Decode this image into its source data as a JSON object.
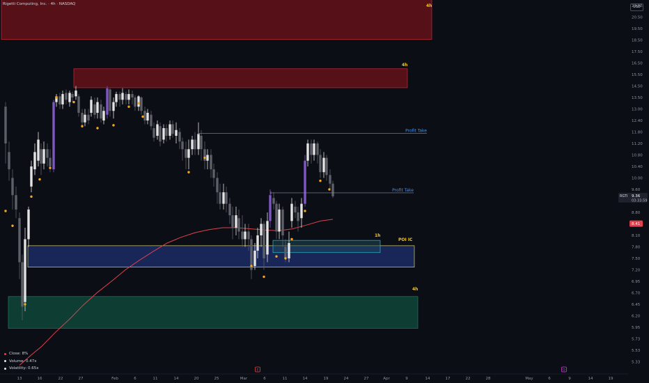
{
  "header": {
    "title": "Rigetti Computing, Inc. · 4h · NASDAQ",
    "currency": "USD"
  },
  "legend": [
    {
      "label": "Close: 8%",
      "color": "#e8e8e8"
    },
    {
      "label": "Volume: 0.47x",
      "color": "#e8e8e8"
    },
    {
      "label": "Volatility: 0.65x",
      "color": "#e8e8e8"
    }
  ],
  "colors": {
    "bull": "#e3e3e3",
    "bear": "#5d6068",
    "impulse": "#7e57c2",
    "dot": "#f5a623",
    "ma": "#e0414c",
    "supply": "#6b1219",
    "poi": "#1c2d6b",
    "demand": "#0f4a3c",
    "accent": "#f5c518"
  },
  "chart_data": {
    "type": "candlestick",
    "symbol": "RGTI",
    "timeframe": "4h",
    "y_ticks": [
      "20.95",
      "20.50",
      "19.50",
      "18.50",
      "17.50",
      "16.50",
      "15.50",
      "14.50",
      "13.50",
      "13.00",
      "12.40",
      "11.80",
      "11.20",
      "10.80",
      "10.40",
      "10.00",
      "9.60",
      "9.20",
      "8.80",
      "8.40",
      "8.10",
      "7.80",
      "7.50",
      "7.20",
      "6.95",
      "6.70",
      "6.45",
      "6.20",
      "5.95",
      "5.73",
      "5.53",
      "5.33"
    ],
    "x_ticks": [
      "13",
      "16",
      "22",
      "27",
      "Feb",
      "6",
      "11",
      "14",
      "20",
      "25",
      "Mar",
      "6",
      "11",
      "14",
      "19",
      "24",
      "27",
      "Apr",
      "9",
      "14",
      "17",
      "22",
      "28",
      "May",
      "6",
      "9",
      "14",
      "19"
    ],
    "price_label": {
      "symbol": "RGTI",
      "price": "9.36",
      "countdown": "03:33:59",
      "color": "#1e222d"
    },
    "ma_label": {
      "value": "8.41",
      "color": "#e0414c"
    },
    "candles": [
      {
        "x": 8,
        "o": 13.1,
        "c": 11.2,
        "h": 13.3,
        "l": 10.5
      },
      {
        "x": 13,
        "o": 10.9,
        "c": 10.3,
        "h": 11.3,
        "l": 9.9
      },
      {
        "x": 18,
        "o": 10.0,
        "c": 9.4,
        "h": 10.3,
        "l": 8.9
      },
      {
        "x": 23,
        "o": 9.4,
        "c": 8.9,
        "h": 9.7,
        "l": 8.6
      },
      {
        "x": 28,
        "o": 8.6,
        "c": 7.4,
        "h": 8.8,
        "l": 7.0
      },
      {
        "x": 32,
        "o": 7.4,
        "c": 6.4,
        "h": 7.6,
        "l": 6.1
      },
      {
        "x": 36,
        "o": 6.5,
        "c": 8.0,
        "h": 8.3,
        "l": 6.3
      },
      {
        "x": 41,
        "o": 8.0,
        "c": 8.9,
        "h": 9.0,
        "l": 7.8
      },
      {
        "x": 45,
        "o": 9.7,
        "c": 10.4,
        "h": 10.6,
        "l": 9.5
      },
      {
        "x": 50,
        "o": 10.3,
        "c": 10.9,
        "h": 11.2,
        "l": 10.1
      },
      {
        "x": 55,
        "o": 10.6,
        "c": 11.4,
        "h": 11.8,
        "l": 10.4
      },
      {
        "x": 59,
        "o": 11.0,
        "c": 10.5,
        "h": 11.2,
        "l": 10.1
      },
      {
        "x": 63,
        "o": 10.5,
        "c": 11.0,
        "h": 11.3,
        "l": 10.3
      },
      {
        "x": 68,
        "o": 11.0,
        "c": 10.7,
        "h": 11.2,
        "l": 10.4
      },
      {
        "x": 72,
        "o": 10.7,
        "c": 10.4,
        "h": 11.0,
        "l": 10.2
      },
      {
        "x": 77,
        "o": 10.3,
        "c": 13.3,
        "h": 13.4,
        "l": 10.2
      },
      {
        "x": 81,
        "o": 13.3,
        "c": 13.6,
        "h": 13.8,
        "l": 13.1
      },
      {
        "x": 86,
        "o": 13.6,
        "c": 13.2,
        "h": 13.9,
        "l": 13.0
      },
      {
        "x": 90,
        "o": 13.2,
        "c": 13.8,
        "h": 14.1,
        "l": 13.0
      },
      {
        "x": 95,
        "o": 13.9,
        "c": 13.4,
        "h": 14.2,
        "l": 13.2
      },
      {
        "x": 100,
        "o": 13.3,
        "c": 13.9,
        "h": 14.1,
        "l": 13.1
      },
      {
        "x": 104,
        "o": 13.8,
        "c": 13.5,
        "h": 14.0,
        "l": 13.3
      },
      {
        "x": 109,
        "o": 13.6,
        "c": 14.1,
        "h": 14.5,
        "l": 13.4
      },
      {
        "x": 113,
        "o": 13.6,
        "c": 12.8,
        "h": 13.8,
        "l": 12.6
      },
      {
        "x": 118,
        "o": 12.8,
        "c": 12.3,
        "h": 13.0,
        "l": 12.1
      },
      {
        "x": 122,
        "o": 12.3,
        "c": 12.7,
        "h": 13.0,
        "l": 12.1
      },
      {
        "x": 127,
        "o": 12.7,
        "c": 12.4,
        "h": 13.0,
        "l": 12.2
      },
      {
        "x": 131,
        "o": 12.8,
        "c": 13.4,
        "h": 13.6,
        "l": 12.6
      },
      {
        "x": 136,
        "o": 13.2,
        "c": 12.7,
        "h": 13.5,
        "l": 12.5
      },
      {
        "x": 140,
        "o": 12.8,
        "c": 13.3,
        "h": 13.5,
        "l": 12.5
      },
      {
        "x": 145,
        "o": 13.2,
        "c": 12.5,
        "h": 13.4,
        "l": 12.3
      },
      {
        "x": 149,
        "o": 12.4,
        "c": 12.9,
        "h": 13.1,
        "l": 12.2
      },
      {
        "x": 154,
        "o": 12.7,
        "c": 14.3,
        "h": 14.5,
        "l": 12.5
      },
      {
        "x": 158,
        "o": 14.2,
        "c": 12.9,
        "h": 14.3,
        "l": 12.6
      },
      {
        "x": 163,
        "o": 12.9,
        "c": 13.3,
        "h": 13.5,
        "l": 12.5
      },
      {
        "x": 167,
        "o": 13.3,
        "c": 13.8,
        "h": 14.0,
        "l": 13.1
      },
      {
        "x": 172,
        "o": 13.8,
        "c": 13.4,
        "h": 14.0,
        "l": 13.1
      },
      {
        "x": 176,
        "o": 13.4,
        "c": 13.9,
        "h": 14.3,
        "l": 13.2
      },
      {
        "x": 181,
        "o": 13.8,
        "c": 13.4,
        "h": 14.0,
        "l": 13.2
      },
      {
        "x": 185,
        "o": 13.4,
        "c": 13.8,
        "h": 14.2,
        "l": 13.2
      },
      {
        "x": 190,
        "o": 13.8,
        "c": 13.5,
        "h": 14.1,
        "l": 13.2
      },
      {
        "x": 194,
        "o": 13.5,
        "c": 13.1,
        "h": 13.7,
        "l": 12.9
      },
      {
        "x": 199,
        "o": 13.1,
        "c": 13.6,
        "h": 13.7,
        "l": 12.9
      },
      {
        "x": 203,
        "o": 13.5,
        "c": 12.9,
        "h": 13.6,
        "l": 12.7
      },
      {
        "x": 208,
        "o": 12.9,
        "c": 12.4,
        "h": 13.1,
        "l": 12.2
      },
      {
        "x": 212,
        "o": 12.4,
        "c": 12.8,
        "h": 13.0,
        "l": 12.2
      },
      {
        "x": 217,
        "o": 12.7,
        "c": 12.1,
        "h": 12.9,
        "l": 11.9
      },
      {
        "x": 221,
        "o": 12.0,
        "c": 11.5,
        "h": 12.3,
        "l": 11.3
      },
      {
        "x": 226,
        "o": 11.6,
        "c": 12.2,
        "h": 12.4,
        "l": 11.4
      },
      {
        "x": 230,
        "o": 12.1,
        "c": 11.3,
        "h": 12.3,
        "l": 11.1
      },
      {
        "x": 235,
        "o": 11.4,
        "c": 12.0,
        "h": 12.2,
        "l": 11.2
      },
      {
        "x": 239,
        "o": 12.0,
        "c": 11.6,
        "h": 12.2,
        "l": 11.3
      },
      {
        "x": 244,
        "o": 11.6,
        "c": 12.2,
        "h": 12.4,
        "l": 11.4
      },
      {
        "x": 248,
        "o": 12.2,
        "c": 11.7,
        "h": 12.4,
        "l": 11.5
      },
      {
        "x": 253,
        "o": 11.6,
        "c": 11.9,
        "h": 12.3,
        "l": 11.2
      },
      {
        "x": 258,
        "o": 11.8,
        "c": 11.3,
        "h": 12.0,
        "l": 11.0
      },
      {
        "x": 262,
        "o": 11.3,
        "c": 11.0,
        "h": 11.5,
        "l": 10.6
      },
      {
        "x": 267,
        "o": 11.0,
        "c": 10.7,
        "h": 11.3,
        "l": 10.3
      },
      {
        "x": 271,
        "o": 10.7,
        "c": 11.0,
        "h": 11.4,
        "l": 10.3
      },
      {
        "x": 276,
        "o": 11.0,
        "c": 11.4,
        "h": 11.6,
        "l": 10.8
      },
      {
        "x": 280,
        "o": 11.4,
        "c": 11.0,
        "h": 11.8,
        "l": 10.8
      },
      {
        "x": 285,
        "o": 11.0,
        "c": 11.7,
        "h": 12.3,
        "l": 10.8
      },
      {
        "x": 289,
        "o": 11.6,
        "c": 11.0,
        "h": 11.9,
        "l": 10.6
      },
      {
        "x": 294,
        "o": 11.0,
        "c": 10.6,
        "h": 11.3,
        "l": 10.3
      },
      {
        "x": 298,
        "o": 10.6,
        "c": 10.8,
        "h": 11.0,
        "l": 10.3
      },
      {
        "x": 303,
        "o": 10.8,
        "c": 10.3,
        "h": 11.0,
        "l": 10.0
      },
      {
        "x": 307,
        "o": 10.3,
        "c": 10.0,
        "h": 10.5,
        "l": 9.7
      },
      {
        "x": 312,
        "o": 10.0,
        "c": 9.5,
        "h": 10.2,
        "l": 9.1
      },
      {
        "x": 316,
        "o": 9.5,
        "c": 9.1,
        "h": 9.8,
        "l": 8.9
      },
      {
        "x": 321,
        "o": 9.1,
        "c": 9.5,
        "h": 9.8,
        "l": 8.9
      },
      {
        "x": 325,
        "o": 9.5,
        "c": 9.1,
        "h": 9.7,
        "l": 8.8
      },
      {
        "x": 330,
        "o": 9.1,
        "c": 8.7,
        "h": 9.3,
        "l": 8.4
      },
      {
        "x": 334,
        "o": 8.7,
        "c": 8.3,
        "h": 9.0,
        "l": 8.0
      },
      {
        "x": 339,
        "o": 8.3,
        "c": 8.7,
        "h": 9.0,
        "l": 8.1
      },
      {
        "x": 343,
        "o": 8.6,
        "c": 8.2,
        "h": 8.9,
        "l": 8.0
      },
      {
        "x": 348,
        "o": 8.2,
        "c": 8.0,
        "h": 8.7,
        "l": 7.8
      },
      {
        "x": 352,
        "o": 8.0,
        "c": 8.2,
        "h": 8.4,
        "l": 7.8
      },
      {
        "x": 357,
        "o": 8.2,
        "c": 8.0,
        "h": 8.4,
        "l": 7.7
      },
      {
        "x": 361,
        "o": 8.0,
        "c": 7.2,
        "h": 8.1,
        "l": 7.0
      },
      {
        "x": 366,
        "o": 7.3,
        "c": 7.7,
        "h": 7.9,
        "l": 7.2
      },
      {
        "x": 370,
        "o": 7.7,
        "c": 8.1,
        "h": 8.3,
        "l": 7.5
      },
      {
        "x": 375,
        "o": 8.1,
        "c": 8.4,
        "h": 8.6,
        "l": 7.8
      },
      {
        "x": 379,
        "o": 8.4,
        "c": 7.5,
        "h": 8.5,
        "l": 7.2
      },
      {
        "x": 384,
        "o": 7.6,
        "c": 8.5,
        "h": 8.8,
        "l": 7.4
      },
      {
        "x": 388,
        "o": 8.5,
        "c": 9.4,
        "h": 9.6,
        "l": 8.3
      },
      {
        "x": 393,
        "o": 9.3,
        "c": 9.1,
        "h": 9.5,
        "l": 8.9
      },
      {
        "x": 397,
        "o": 9.1,
        "c": 8.2,
        "h": 9.2,
        "l": 8.0
      },
      {
        "x": 401,
        "o": 8.2,
        "c": 8.9,
        "h": 9.1,
        "l": 8.0
      },
      {
        "x": 406,
        "o": 8.9,
        "c": 8.1,
        "h": 9.0,
        "l": 7.8
      },
      {
        "x": 410,
        "o": 7.8,
        "c": 7.5,
        "h": 8.0,
        "l": 7.4
      },
      {
        "x": 415,
        "o": 7.5,
        "c": 7.9,
        "h": 8.2,
        "l": 7.4
      },
      {
        "x": 419,
        "o": 8.5,
        "c": 9.1,
        "h": 9.3,
        "l": 8.3
      },
      {
        "x": 424,
        "o": 9.0,
        "c": 8.8,
        "h": 9.2,
        "l": 8.6
      },
      {
        "x": 428,
        "o": 8.8,
        "c": 8.5,
        "h": 9.0,
        "l": 8.2
      },
      {
        "x": 433,
        "o": 8.6,
        "c": 9.1,
        "h": 9.3,
        "l": 8.3
      },
      {
        "x": 438,
        "o": 9.1,
        "c": 10.6,
        "h": 10.8,
        "l": 9.0
      },
      {
        "x": 442,
        "o": 10.6,
        "c": 11.2,
        "h": 11.4,
        "l": 10.4
      },
      {
        "x": 447,
        "o": 11.2,
        "c": 10.8,
        "h": 11.4,
        "l": 10.5
      },
      {
        "x": 451,
        "o": 10.8,
        "c": 11.2,
        "h": 11.4,
        "l": 10.6
      },
      {
        "x": 456,
        "o": 11.2,
        "c": 10.8,
        "h": 11.3,
        "l": 10.5
      },
      {
        "x": 460,
        "o": 10.8,
        "c": 10.2,
        "h": 11.0,
        "l": 10.0
      },
      {
        "x": 465,
        "o": 10.2,
        "c": 10.7,
        "h": 10.9,
        "l": 10.0
      },
      {
        "x": 469,
        "o": 10.7,
        "c": 10.1,
        "h": 10.8,
        "l": 9.9
      },
      {
        "x": 474,
        "o": 10.1,
        "c": 9.8,
        "h": 10.3,
        "l": 9.6
      },
      {
        "x": 478,
        "o": 9.8,
        "c": 9.36,
        "h": 9.9,
        "l": 9.3
      }
    ],
    "impulse_candles": [
      77,
      154,
      388,
      438
    ],
    "dots": [
      {
        "x": 8,
        "y": 8.85
      },
      {
        "x": 18,
        "y": 8.35
      },
      {
        "x": 36,
        "y": 6.45
      },
      {
        "x": 45,
        "y": 9.35
      },
      {
        "x": 57,
        "y": 9.95
      },
      {
        "x": 72,
        "y": 10.35
      },
      {
        "x": 81,
        "y": 13.5
      },
      {
        "x": 106,
        "y": 13.3
      },
      {
        "x": 118,
        "y": 12.1
      },
      {
        "x": 140,
        "y": 12.0
      },
      {
        "x": 163,
        "y": 12.15
      },
      {
        "x": 185,
        "y": 13.1
      },
      {
        "x": 199,
        "y": 13.25
      },
      {
        "x": 205,
        "y": 12.6
      },
      {
        "x": 271,
        "y": 10.2
      },
      {
        "x": 294,
        "y": 10.7
      },
      {
        "x": 361,
        "y": 7.3
      },
      {
        "x": 379,
        "y": 7.05
      },
      {
        "x": 397,
        "y": 7.55
      },
      {
        "x": 410,
        "y": 7.5
      },
      {
        "x": 419,
        "y": 8.0
      },
      {
        "x": 438,
        "y": 8.85
      },
      {
        "x": 460,
        "y": 9.9
      },
      {
        "x": 473,
        "y": 9.6
      }
    ],
    "ma": [
      {
        "x": 28,
        "y": 5.27
      },
      {
        "x": 45,
        "y": 5.45
      },
      {
        "x": 60,
        "y": 5.6
      },
      {
        "x": 80,
        "y": 5.86
      },
      {
        "x": 100,
        "y": 6.13
      },
      {
        "x": 120,
        "y": 6.44
      },
      {
        "x": 140,
        "y": 6.71
      },
      {
        "x": 160,
        "y": 6.95
      },
      {
        "x": 180,
        "y": 7.2
      },
      {
        "x": 200,
        "y": 7.45
      },
      {
        "x": 220,
        "y": 7.68
      },
      {
        "x": 240,
        "y": 7.9
      },
      {
        "x": 260,
        "y": 8.05
      },
      {
        "x": 280,
        "y": 8.17
      },
      {
        "x": 300,
        "y": 8.25
      },
      {
        "x": 320,
        "y": 8.3
      },
      {
        "x": 340,
        "y": 8.3
      },
      {
        "x": 360,
        "y": 8.27
      },
      {
        "x": 380,
        "y": 8.24
      },
      {
        "x": 400,
        "y": 8.22
      },
      {
        "x": 420,
        "y": 8.27
      },
      {
        "x": 440,
        "y": 8.37
      },
      {
        "x": 460,
        "y": 8.5
      },
      {
        "x": 478,
        "y": 8.56
      }
    ],
    "zones": [
      {
        "kind": "supply",
        "x1": 2,
        "x2": 620,
        "ytop": 21.5,
        "ybot": 18.55,
        "label": "4h",
        "ly": 20.95
      },
      {
        "kind": "supply",
        "x1": 106,
        "x2": 585,
        "ytop": 16.0,
        "ybot": 14.35,
        "label": "4h",
        "ly": 16.35
      },
      {
        "kind": "poi",
        "x1": 40,
        "x2": 595,
        "ytop": 7.83,
        "ybot": 7.27,
        "label": "POI IC",
        "ly": 7.99
      },
      {
        "kind": "poi1h",
        "x1": 392,
        "x2": 546,
        "ytop": 7.97,
        "ybot": 7.65,
        "label": "1h",
        "ly": 8.1
      },
      {
        "kind": "demand",
        "x1": 12,
        "x2": 600,
        "ytop": 6.62,
        "ybot": 5.93,
        "label": "4h",
        "ly": 6.78
      }
    ],
    "profit_takes": [
      {
        "x1": 285,
        "x2": 613,
        "y": 11.72,
        "label": "Profit Take"
      },
      {
        "x1": 389,
        "x2": 594,
        "y": 9.48,
        "label": "Profit Take"
      }
    ],
    "event_markers": [
      {
        "x": 370,
        "color": "#e0414c",
        "text": "E"
      },
      {
        "x": 810,
        "color": "#d43adf",
        "text": "D"
      }
    ]
  }
}
